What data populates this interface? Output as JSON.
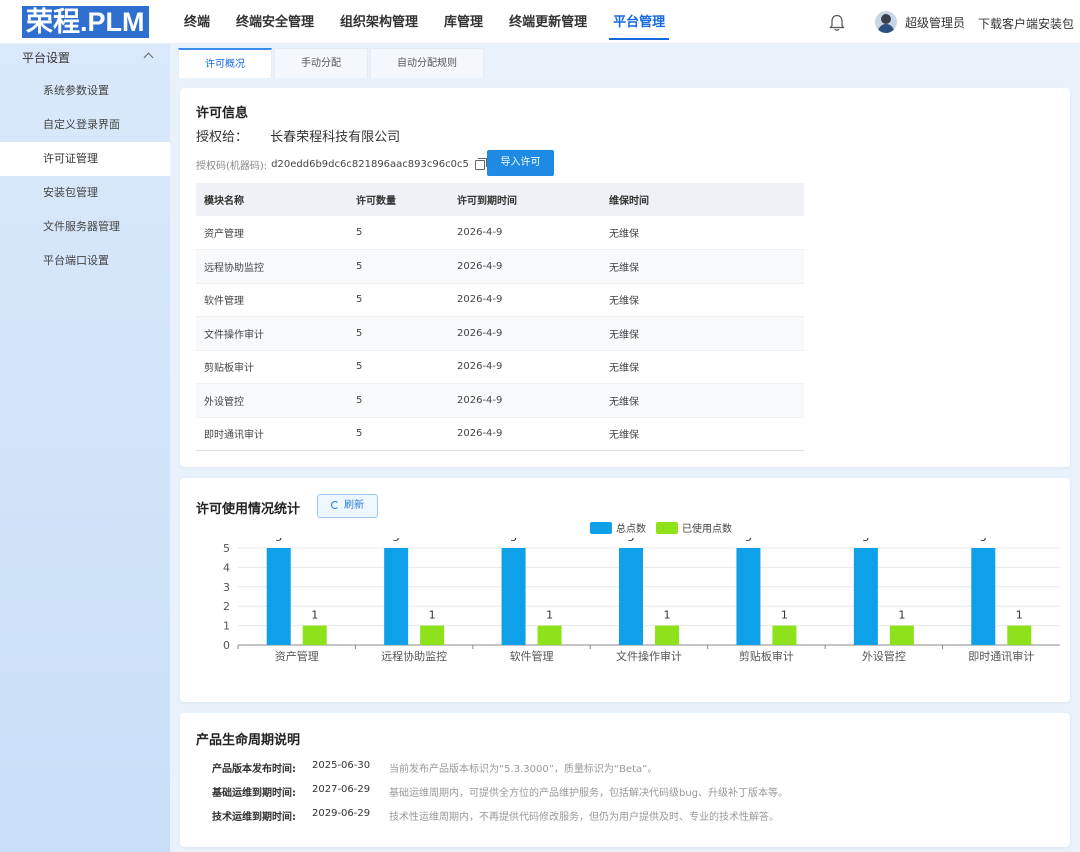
{
  "header": {
    "logo": "荣程.PLM",
    "nav": [
      {
        "label": "终端"
      },
      {
        "label": "终端安全管理"
      },
      {
        "label": "组织架构管理"
      },
      {
        "label": "库管理"
      },
      {
        "label": "终端更新管理"
      },
      {
        "label": "平台管理",
        "active": true
      }
    ],
    "user_name": "超级管理员",
    "download_label": "下载客户端安装包"
  },
  "sidebar": {
    "group_label": "平台设置",
    "items": [
      {
        "label": "系统参数设置"
      },
      {
        "label": "自定义登录界面"
      },
      {
        "label": "许可证管理",
        "active": true
      },
      {
        "label": "安装包管理"
      },
      {
        "label": "文件服务器管理"
      },
      {
        "label": "平台端口设置"
      }
    ]
  },
  "tabs": [
    {
      "label": "许可概况",
      "active": true
    },
    {
      "label": "手动分配"
    },
    {
      "label": "自动分配规则"
    }
  ],
  "license": {
    "title": "许可信息",
    "auth_label": "授权给：",
    "auth_value": "长春荣程科技有限公司",
    "code_label": "授权码(机器码):",
    "code_value": "d20edd6b9dc6c821896aac893c96c0c5",
    "import_button": "导入许可",
    "columns": [
      "模块名称",
      "许可数量",
      "许可到期时间",
      "维保时间"
    ],
    "rows": [
      [
        "资产管理",
        "5",
        "2026-4-9",
        "无维保"
      ],
      [
        "远程协助监控",
        "5",
        "2026-4-9",
        "无维保"
      ],
      [
        "软件管理",
        "5",
        "2026-4-9",
        "无维保"
      ],
      [
        "文件操作审计",
        "5",
        "2026-4-9",
        "无维保"
      ],
      [
        "剪贴板审计",
        "5",
        "2026-4-9",
        "无维保"
      ],
      [
        "外设管控",
        "5",
        "2026-4-9",
        "无维保"
      ],
      [
        "即时通讯审计",
        "5",
        "2026-4-9",
        "无维保"
      ]
    ]
  },
  "usage": {
    "title": "许可使用情况统计",
    "refresh_button": "刷新"
  },
  "chart_data": {
    "type": "bar",
    "categories": [
      "资产管理",
      "远程协助监控",
      "软件管理",
      "文件操作审计",
      "剪贴板审计",
      "外设管控",
      "即时通讯审计"
    ],
    "series": [
      {
        "name": "总点数",
        "values": [
          5,
          5,
          5,
          5,
          5,
          5,
          5
        ],
        "color": "#0ea0e8"
      },
      {
        "name": "已使用点数",
        "values": [
          1,
          1,
          1,
          1,
          1,
          1,
          1
        ],
        "color": "#8ee21a"
      }
    ],
    "yticks": [
      "0",
      "1",
      "2",
      "3",
      "4",
      "5"
    ],
    "ylim": [
      0,
      5
    ],
    "legend": "top-center",
    "grid": true
  },
  "lifecycle": {
    "title": "产品生命周期说明",
    "rows": [
      {
        "key": "产品版本发布时间:",
        "date": "2025-06-30",
        "text": "当前发布产品版本标识为“5.3.3000”，质量标识为“Beta”。"
      },
      {
        "key": "基础运维到期时间:",
        "date": "2027-06-29",
        "text": "基础运维周期内，可提供全方位的产品维护服务，包括解决代码级bug、升级补丁版本等。"
      },
      {
        "key": "技术运维到期时间:",
        "date": "2029-06-29",
        "text": "技术性运维周期内，不再提供代码修改服务，但仍为用户提供及时、专业的技术性解答。"
      }
    ]
  },
  "colors": {
    "accent": "#1769e0",
    "button": "#1f8ae3"
  }
}
